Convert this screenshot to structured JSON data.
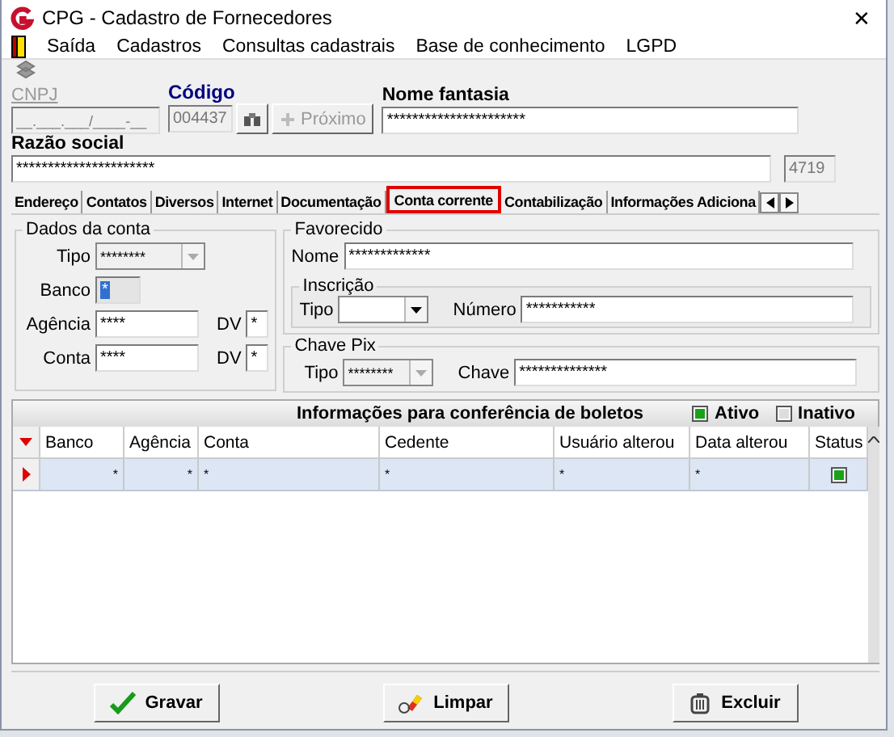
{
  "window": {
    "title": "CPG - Cadastro de Fornecedores",
    "close": "✕"
  },
  "menu": [
    "Saída",
    "Cadastros",
    "Consultas cadastrais",
    "Base de conhecimento",
    "LGPD"
  ],
  "header": {
    "cnpj": {
      "label": "CNPJ",
      "value": "__.___.___/____-__",
      "disabled": true
    },
    "codigo": {
      "label": "Código",
      "value": "004437",
      "disabled": true
    },
    "proximo": {
      "label": "Próximo",
      "disabled": true
    },
    "nome_fantasia": {
      "label": "Nome fantasia",
      "value": "**********************"
    },
    "razao_social": {
      "label": "Razão social",
      "value": "**********************"
    },
    "number_field": {
      "value": "4719",
      "disabled": true
    }
  },
  "tabs": [
    {
      "label": "Endereço",
      "selected": false
    },
    {
      "label": "Contatos",
      "selected": false
    },
    {
      "label": "Diversos",
      "selected": false
    },
    {
      "label": "Internet",
      "selected": false
    },
    {
      "label": "Documentação",
      "selected": false
    },
    {
      "label": "Conta corrente",
      "selected": true
    },
    {
      "label": "Contabilização",
      "selected": false
    },
    {
      "label": "Informações Adiciona",
      "selected": false
    }
  ],
  "dados_conta": {
    "title": "Dados da conta",
    "tipo": {
      "label": "Tipo",
      "value": "********",
      "disabled": true
    },
    "banco": {
      "label": "Banco",
      "value": "*"
    },
    "agencia": {
      "label": "Agência",
      "value": "****"
    },
    "agencia_dv": {
      "label": "DV",
      "value": "*"
    },
    "conta": {
      "label": "Conta",
      "value": "****"
    },
    "conta_dv": {
      "label": "DV",
      "value": "*"
    }
  },
  "favorecido": {
    "title": "Favorecido",
    "nome": {
      "label": "Nome",
      "value": "*************"
    },
    "inscricao": {
      "title": "Inscrição",
      "tipo": {
        "label": "Tipo",
        "disabled": false
      },
      "numero": {
        "label": "Número",
        "value": "***********"
      }
    }
  },
  "chave_pix": {
    "title": "Chave Pix",
    "tipo": {
      "label": "Tipo",
      "value": "********",
      "disabled": true
    },
    "chave": {
      "label": "Chave",
      "value": "**************"
    }
  },
  "boletos": {
    "title": "Informações para conferência de boletos",
    "legend": [
      {
        "label": "Ativo",
        "active": true
      },
      {
        "label": "Inativo",
        "active": false
      }
    ],
    "columns": [
      "Banco",
      "Agência",
      "Conta",
      "Cedente",
      "Usuário alterou",
      "Data alterou",
      "Status"
    ],
    "rows": [
      {
        "cells": [
          "*",
          "*",
          "*",
          "*",
          "*",
          "*"
        ],
        "active": true,
        "selected": true
      }
    ]
  },
  "buttons": [
    {
      "kind": "save",
      "label": "Gravar"
    },
    {
      "kind": "clear",
      "label": "Limpar"
    },
    {
      "kind": "delete",
      "label": "Excluir"
    }
  ]
}
